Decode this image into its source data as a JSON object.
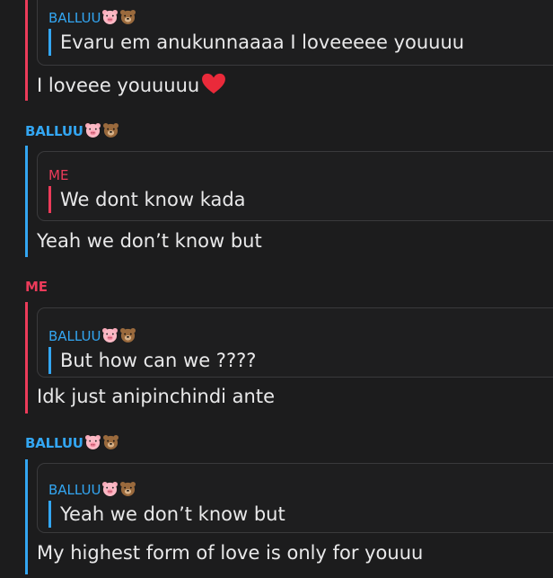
{
  "messages": [
    {
      "sender": "",
      "quote": {
        "sender": "BALLUU",
        "text": "Evaru em anukunnaaaa I loveeeee youuuu"
      },
      "reply": "I loveee youuuuu"
    },
    {
      "sender": "BALLUU",
      "quote": {
        "sender": "ME",
        "text": "We dont know kada"
      },
      "reply": "Yeah we don’t know but"
    },
    {
      "sender": "ME",
      "quote": {
        "sender": "BALLUU",
        "text": "But how can we ????"
      },
      "reply": "Idk just anipinchindi ante"
    },
    {
      "sender": "BALLUU",
      "quote": {
        "sender": "BALLUU",
        "text": "Yeah we don’t know but"
      },
      "reply": "My highest form of love is only for youuu"
    }
  ],
  "colors": {
    "background": "#1c1c1d",
    "balluu_accent": "#33a6f2",
    "me_accent": "#ec3b5a",
    "text": "#e9e9ea",
    "quote_border": "#3a3a3c"
  },
  "icons": {
    "sender_suffix": [
      "pig-face-icon",
      "bear-face-icon"
    ],
    "reply_suffix": "red-heart-icon"
  }
}
